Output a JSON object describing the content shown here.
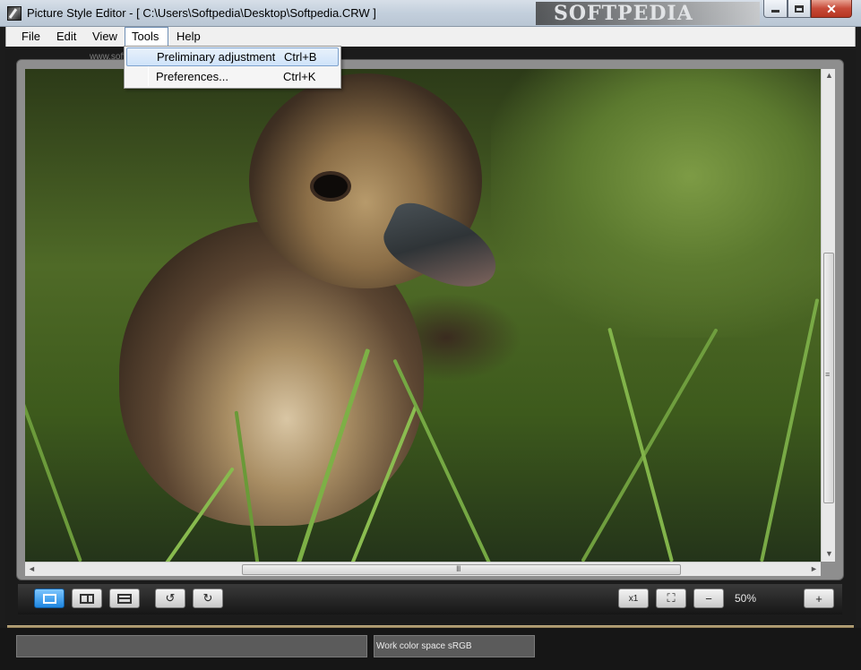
{
  "window": {
    "title": "Picture Style Editor - [ C:\\Users\\Softpedia\\Desktop\\Softpedia.CRW ]",
    "brand_overlay": "SOFTPEDIA",
    "close_glyph": "✕"
  },
  "menubar": {
    "items": [
      "File",
      "Edit",
      "View",
      "Tools",
      "Help"
    ],
    "active_item": "Tools",
    "watermark": "www.softpedia.com"
  },
  "tools_menu": {
    "items": [
      {
        "label": "Preliminary adjustment",
        "shortcut": "Ctrl+B",
        "highlighted": true
      },
      {
        "label": "Preferences...",
        "shortcut": "Ctrl+K",
        "highlighted": false
      }
    ]
  },
  "viewer": {
    "image_description_icon": "duckling-photo",
    "vscroll_grip": "≡",
    "hscroll_grip": "III",
    "arrow_up": "▲",
    "arrow_down": "▼",
    "arrow_left": "◄",
    "arrow_right": "►"
  },
  "toolbar": {
    "zoom_level": "50%",
    "rotate_left": "↺",
    "rotate_right": "↻",
    "zoom_out": "−",
    "zoom_in": "+",
    "actual_pixels": "x1",
    "fit": "⛶"
  },
  "status": {
    "color_space": "Work color space  sRGB"
  },
  "colors": {
    "selected_button": "#1f86e0",
    "menu_highlight": "#cfe3f9"
  }
}
